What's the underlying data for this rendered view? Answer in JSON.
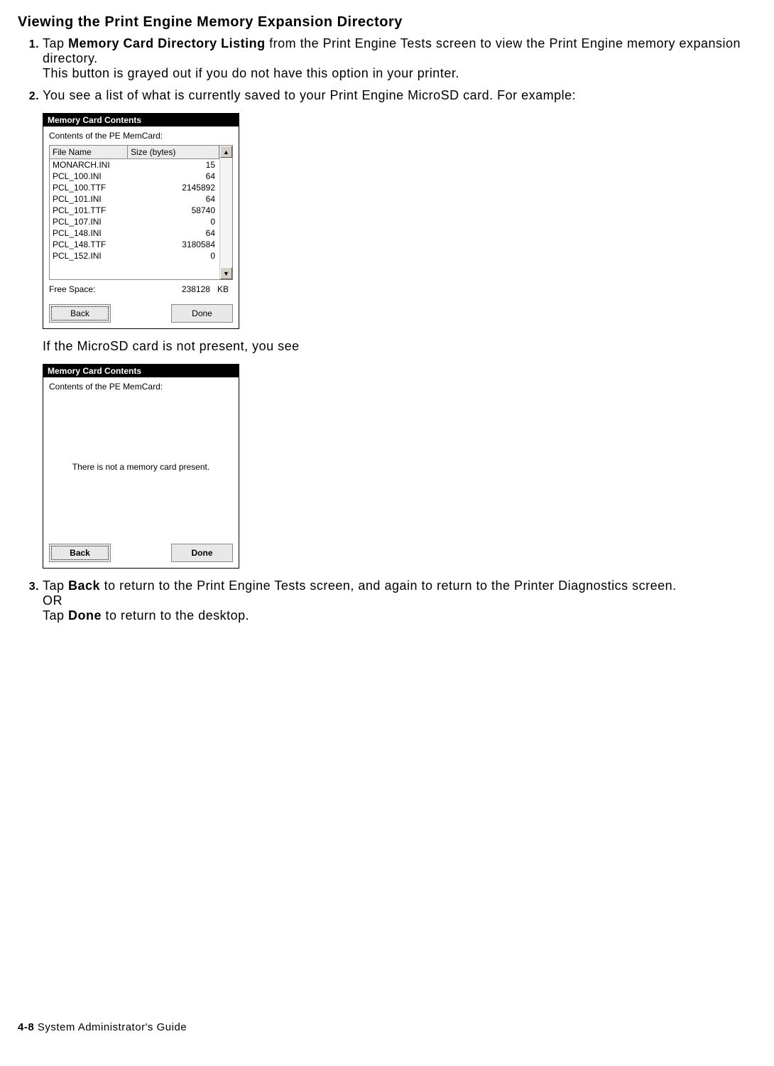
{
  "heading": "Viewing the Print Engine Memory Expansion Directory",
  "steps": {
    "s1_bold": "Memory Card Directory Listing",
    "s1_a": "Tap ",
    "s1_b": " from the Print Engine Tests screen to view the Print Engine memory expansion directory.",
    "s1_c": "This button is grayed out if you do not have this option in your printer.",
    "s2": "You see a list of what is currently saved to your Print Engine MicroSD card.  For example:",
    "s2_note": "If the MicroSD card is not present, you see",
    "s3_a": "Tap ",
    "s3_bold1": "Back",
    "s3_b": " to return to the Print Engine Tests screen, and again to return to the Printer Diagnostics screen.",
    "s3_or": "OR",
    "s3_c": "Tap ",
    "s3_bold2": "Done",
    "s3_d": " to return to the desktop."
  },
  "dialog1": {
    "title": "Memory Card Contents",
    "subtitle": "Contents of the PE MemCard:",
    "col_name": "File Name",
    "col_size": "Size (bytes)",
    "rows": [
      {
        "name": "MONARCH.INI",
        "size": "15"
      },
      {
        "name": "PCL_100.INI",
        "size": "64"
      },
      {
        "name": "PCL_100.TTF",
        "size": "2145892"
      },
      {
        "name": "PCL_101.INI",
        "size": "64"
      },
      {
        "name": "PCL_101.TTF",
        "size": "58740"
      },
      {
        "name": "PCL_107.INI",
        "size": "0"
      },
      {
        "name": "PCL_148.INI",
        "size": "64"
      },
      {
        "name": "PCL_148.TTF",
        "size": "3180584"
      },
      {
        "name": "PCL_152.INI",
        "size": "0"
      }
    ],
    "free_label": "Free Space:",
    "free_value": "238128",
    "free_unit": "KB",
    "back": "Back",
    "done": "Done"
  },
  "dialog2": {
    "title": "Memory Card Contents",
    "subtitle": "Contents of the PE MemCard:",
    "message": "There is not a memory card present.",
    "back": "Back",
    "done": "Done"
  },
  "footer": {
    "page": "4-8",
    "title": "  System Administrator's Guide"
  }
}
